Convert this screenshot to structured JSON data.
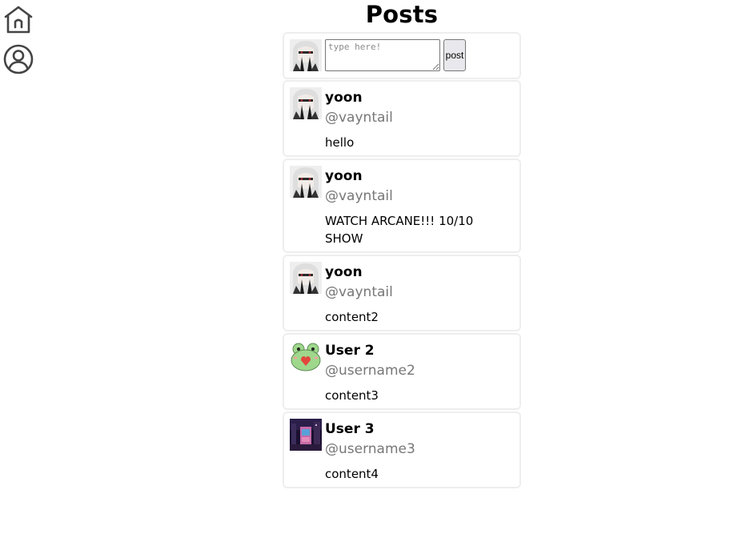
{
  "page": {
    "title": "Posts"
  },
  "nav": {
    "home_icon": "home-icon",
    "profile_icon": "user-circle-icon"
  },
  "composer": {
    "placeholder": "type here!",
    "value": "",
    "post_label": "post"
  },
  "posts": [
    {
      "name": "yoon",
      "handle": "@vayntail",
      "content": "hello",
      "avatar": "yoon-avatar"
    },
    {
      "name": "yoon",
      "handle": "@vayntail",
      "content": "WATCH ARCANE!!! 10/10 SHOW",
      "avatar": "yoon-avatar"
    },
    {
      "name": "yoon",
      "handle": "@vayntail",
      "content": "content2",
      "avatar": "yoon-avatar"
    },
    {
      "name": "User 2",
      "handle": "@username2",
      "content": "content3",
      "avatar": "frog-avatar"
    },
    {
      "name": "User 3",
      "handle": "@username3",
      "content": "content4",
      "avatar": "night-scene-avatar"
    }
  ],
  "colors": {
    "border": "#eeeeee",
    "handle": "#777777",
    "icon_stroke": "#444444"
  }
}
